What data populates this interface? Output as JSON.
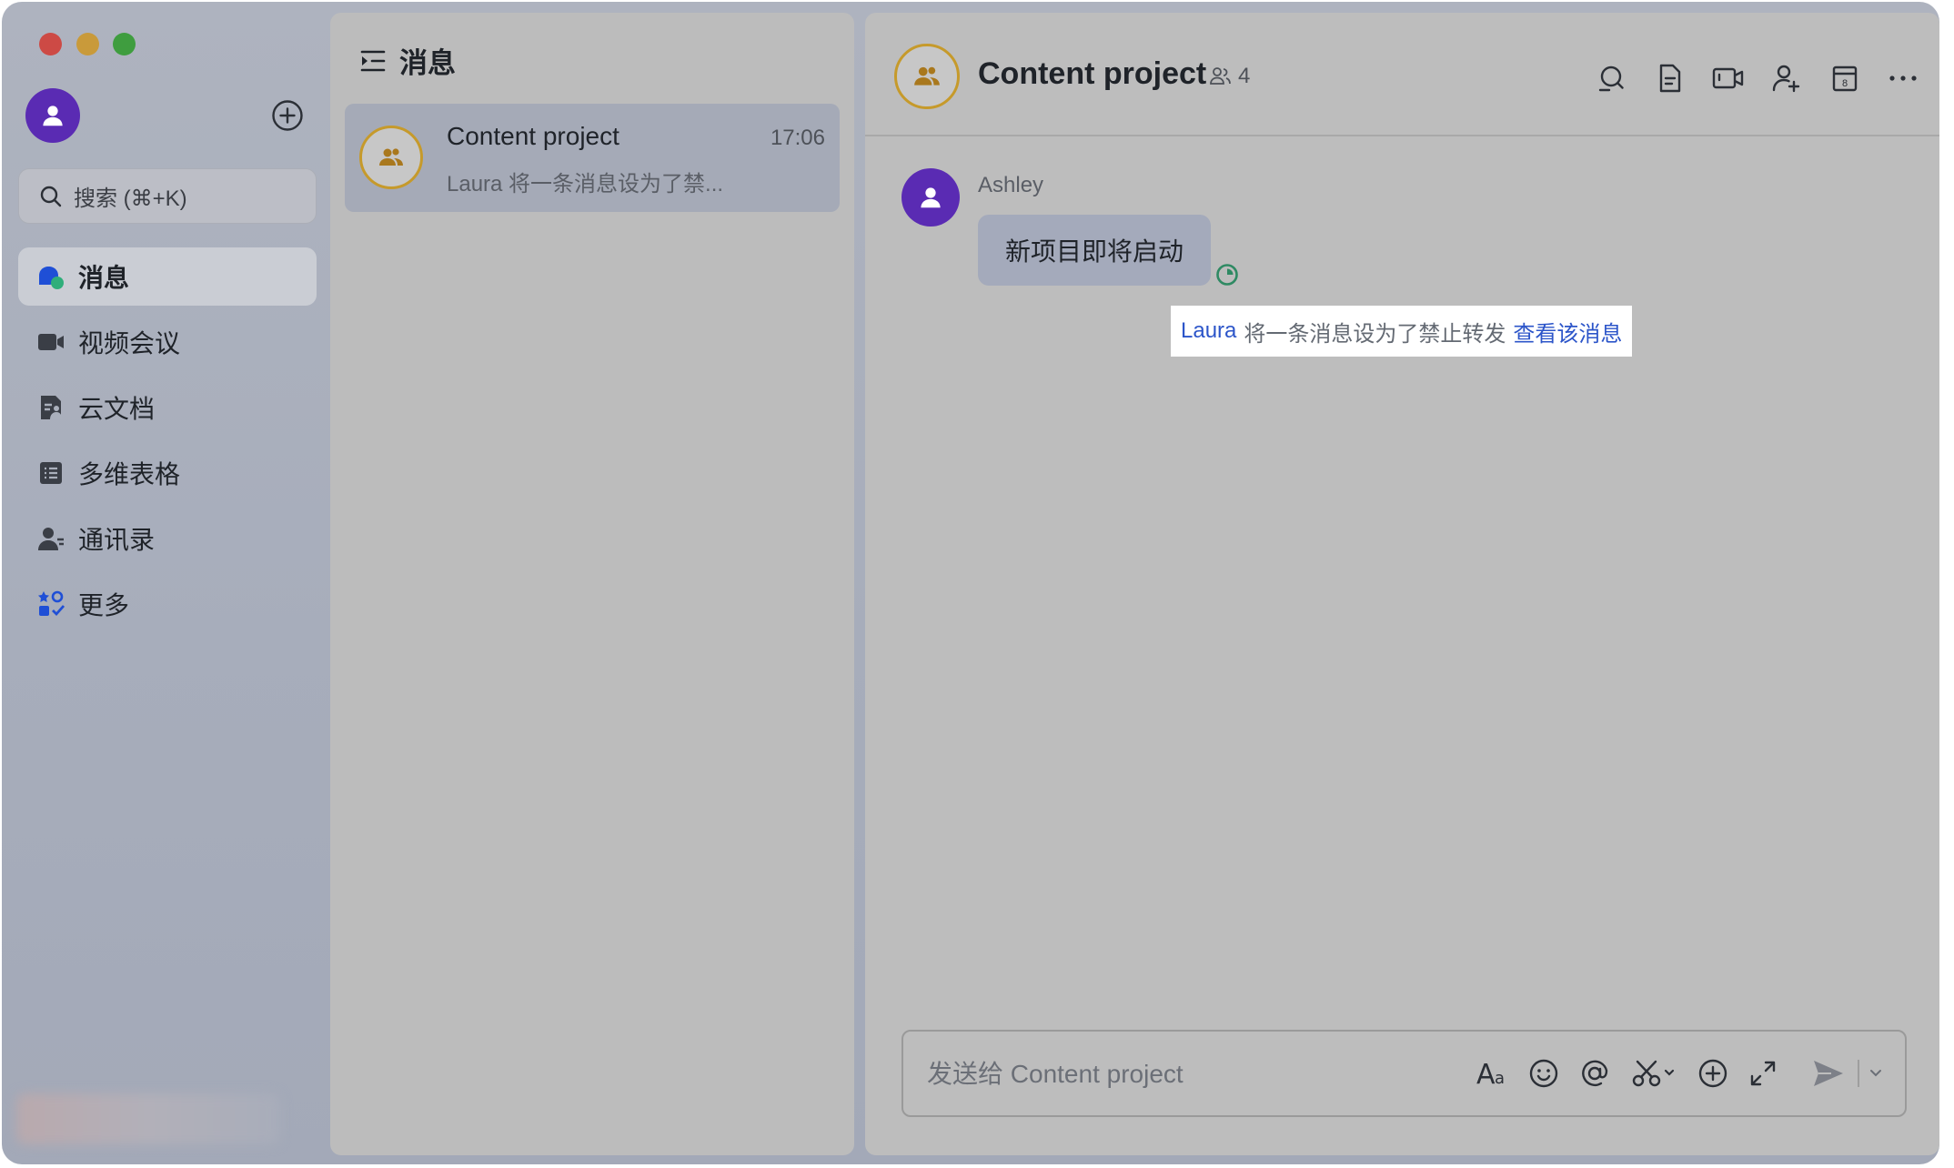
{
  "sidebar": {
    "search_placeholder": "搜索 (⌘+K)",
    "items": [
      {
        "label": "消息",
        "icon": "message-icon",
        "active": true
      },
      {
        "label": "视频会议",
        "icon": "video-meeting-icon"
      },
      {
        "label": "云文档",
        "icon": "cloud-docs-icon"
      },
      {
        "label": "多维表格",
        "icon": "base-table-icon"
      },
      {
        "label": "通讯录",
        "icon": "contacts-icon"
      },
      {
        "label": "更多",
        "icon": "more-apps-icon"
      }
    ]
  },
  "list": {
    "title": "消息",
    "chats": [
      {
        "name": "Content project",
        "time": "17:06",
        "preview": "Laura 将一条消息设为了禁..."
      }
    ]
  },
  "chat": {
    "title": "Content project",
    "member_count": "4",
    "messages": [
      {
        "sender": "Ashley",
        "text": "新项目即将启动"
      }
    ],
    "system_notice": {
      "user": "Laura",
      "text": "将一条消息设为了禁止转发",
      "link": "查看该消息"
    },
    "composer_placeholder": "发送给 Content project"
  },
  "colors": {
    "user_avatar": "#5a2bb3",
    "group_avatar_ring": "#c69a2b",
    "link_blue": "#2c55c9",
    "read_receipt": "#2f8a63"
  }
}
